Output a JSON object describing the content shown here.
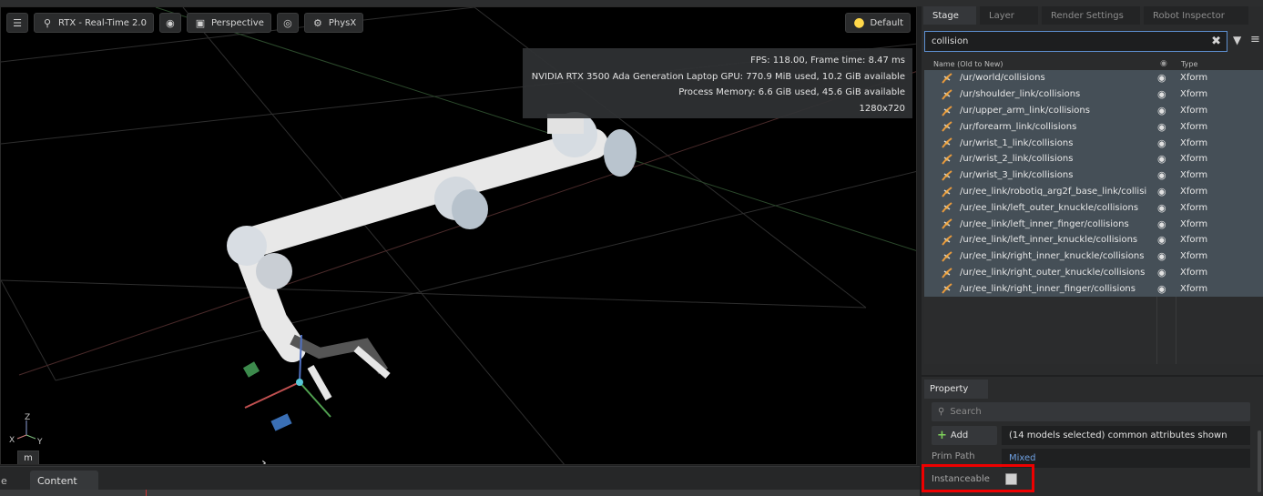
{
  "toolbar": {
    "renderer_label": "RTX - Real-Time 2.0",
    "camera_label": "Perspective",
    "physx_label": "PhysX",
    "lighting_label": "Default"
  },
  "stats": {
    "line1": "FPS: 118.00, Frame time: 8.47 ms",
    "line2": "NVIDIA RTX 3500 Ada Generation Laptop GPU: 770.9 MiB used, 10.2 GiB available",
    "line3": "Process Memory: 6.6 GiB used, 45.6 GiB available",
    "line4": "1280x720"
  },
  "gizmo": {
    "z": "Z",
    "x": "X",
    "y": "Y"
  },
  "viewport": {
    "m_label": "m",
    "expand_glyph": "›"
  },
  "bottom": {
    "prev_tab": "e",
    "content_tab": "Content"
  },
  "stage_panel": {
    "tabs": [
      "Stage",
      "Layer",
      "Render Settings",
      "Robot Inspector"
    ],
    "search_value": "collision",
    "header_name": "Name (Old to New)",
    "header_type": "Type",
    "rows": [
      {
        "path": "/ur/world/collisions",
        "type": "Xform"
      },
      {
        "path": "/ur/shoulder_link/collisions",
        "type": "Xform"
      },
      {
        "path": "/ur/upper_arm_link/collisions",
        "type": "Xform"
      },
      {
        "path": "/ur/forearm_link/collisions",
        "type": "Xform"
      },
      {
        "path": "/ur/wrist_1_link/collisions",
        "type": "Xform"
      },
      {
        "path": "/ur/wrist_2_link/collisions",
        "type": "Xform"
      },
      {
        "path": "/ur/wrist_3_link/collisions",
        "type": "Xform"
      },
      {
        "path": "/ur/ee_link/robotiq_arg2f_base_link/collisi",
        "type": "Xform"
      },
      {
        "path": "/ur/ee_link/left_outer_knuckle/collisions",
        "type": "Xform"
      },
      {
        "path": "/ur/ee_link/left_inner_finger/collisions",
        "type": "Xform"
      },
      {
        "path": "/ur/ee_link/left_inner_knuckle/collisions",
        "type": "Xform"
      },
      {
        "path": "/ur/ee_link/right_inner_knuckle/collisions",
        "type": "Xform"
      },
      {
        "path": "/ur/ee_link/right_outer_knuckle/collisions",
        "type": "Xform"
      },
      {
        "path": "/ur/ee_link/right_inner_finger/collisions",
        "type": "Xform"
      }
    ]
  },
  "property_panel": {
    "tab": "Property",
    "search_placeholder": "Search",
    "add_label": "Add",
    "models_info": "(14 models selected) common attributes shown",
    "prim_path_label": "Prim Path",
    "prim_path_value": "Mixed",
    "instanceable_label": "Instanceable"
  },
  "colors": {
    "selection_row": "#454f57",
    "search_border": "#5d8fcf",
    "highlight_box": "#ee0000",
    "lighting_icon": "#ffd84a"
  }
}
